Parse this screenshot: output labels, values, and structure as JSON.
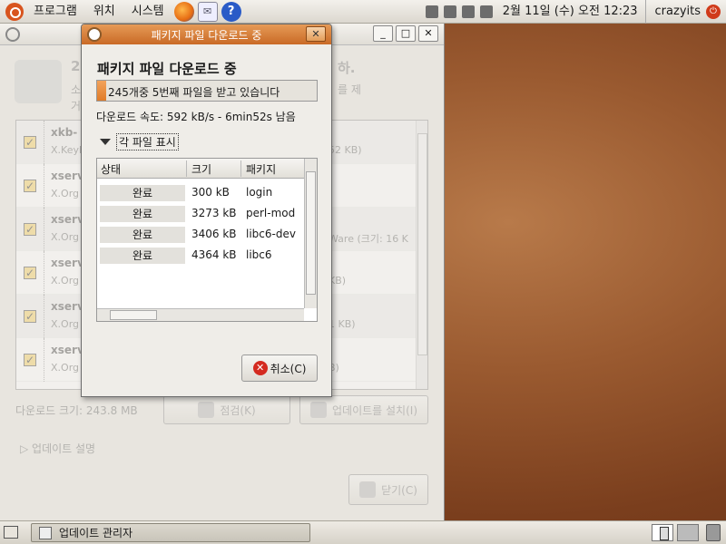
{
  "top_panel": {
    "menus": [
      "프로그램",
      "위치",
      "시스템"
    ],
    "clock": "2월 11일 (수) 오전 12:23",
    "user": "crazyits"
  },
  "main_window": {
    "header": {
      "title_left": "24",
      "title_right": "하.",
      "sub1_left": "소",
      "sub1_right": "를 제",
      "sub2_left": "거"
    },
    "packages": [
      {
        "name": "xkb-",
        "desc": "X.Keyb",
        "right": "52 KB)"
      },
      {
        "name": "xserv",
        "desc": "X.Org",
        "right": ""
      },
      {
        "name": "xserv",
        "desc": "X.Org",
        "right": "Ware (크기: 16 K"
      },
      {
        "name": "xserv",
        "desc": "X.Org",
        "right": "KB)"
      },
      {
        "name": "xserv",
        "desc": "X.Org",
        "right": "1 KB)"
      },
      {
        "name": "xserv",
        "desc": "X.Org",
        "right": "B)"
      }
    ],
    "download_size": "다운로드 크기: 243.8 MB",
    "check_button": "점검(K)",
    "install_button": "업데이트를 설치(I)",
    "update_description": "업데이트 설명",
    "close_button": "닫기(C)"
  },
  "dialog": {
    "title": "패키지 파일 다운로드 중",
    "heading": "패키지 파일 다운로드 중",
    "progress_text": "245개중 5번째 파일을 받고 있습니다",
    "progress_fraction": 0.04,
    "speed": "다운로드 속도: 592 kB/s - 6min52s 남음",
    "expander_label": "각 파일 표시",
    "columns": [
      "상태",
      "크기",
      "패키지"
    ],
    "files": [
      {
        "status": "완료",
        "size": "300 kB",
        "package": "login"
      },
      {
        "status": "완료",
        "size": "3273 kB",
        "package": "perl-mod"
      },
      {
        "status": "완료",
        "size": "3406 kB",
        "package": "libc6-dev"
      },
      {
        "status": "완료",
        "size": "4364 kB",
        "package": "libc6"
      }
    ],
    "cancel_button": "취소(C)"
  },
  "taskbar": {
    "window_label": "업데이트 관리자"
  }
}
